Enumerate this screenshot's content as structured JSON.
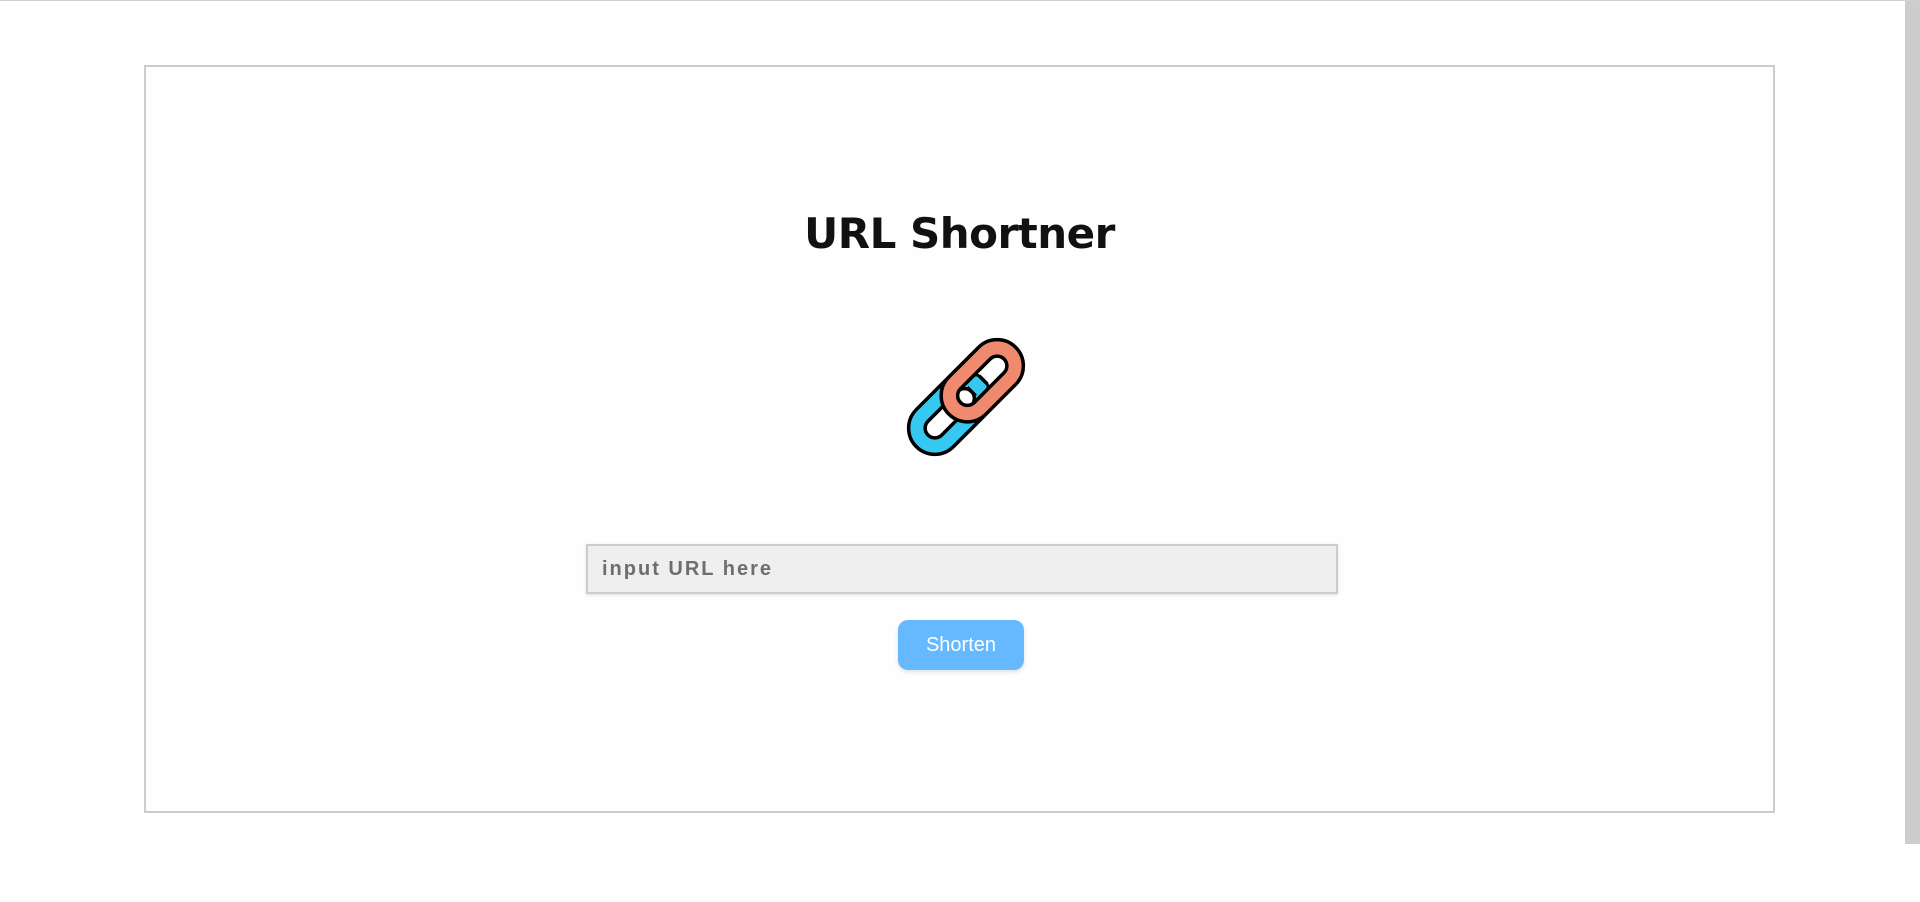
{
  "app": {
    "title": "URL Shortner"
  },
  "logo": {
    "icon": "link-chain-icon",
    "colors": {
      "left_link": "#35c8f0",
      "right_link": "#f08a6e",
      "outline": "#000000"
    }
  },
  "form": {
    "input_placeholder": "input URL here",
    "input_value": "",
    "submit_label": "Shorten"
  },
  "theme": {
    "accent": "#66b8ff",
    "card_border": "#cccccc",
    "input_background": "#efefef"
  }
}
